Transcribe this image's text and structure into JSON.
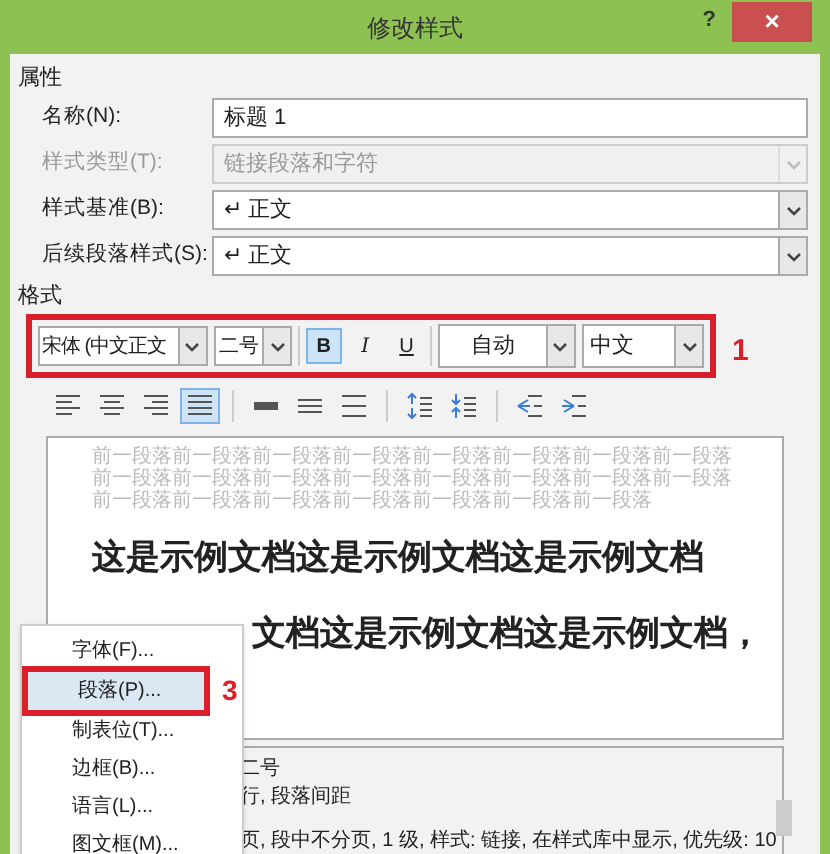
{
  "window": {
    "title": "修改样式",
    "help": "?",
    "close": "×"
  },
  "properties": {
    "heading": "属性",
    "fields": [
      {
        "label": "名称(N):",
        "value": "标题 1",
        "kind": "text",
        "disabled": false
      },
      {
        "label": "样式类型(T):",
        "value": "链接段落和字符",
        "kind": "select",
        "disabled": true
      },
      {
        "label": "样式基准(B):",
        "value": "↵ 正文",
        "kind": "select",
        "disabled": false
      },
      {
        "label": "后续段落样式(S):",
        "value": "↵ 正文",
        "kind": "select",
        "disabled": false
      }
    ]
  },
  "format": {
    "heading": "格式",
    "font": "宋体 (中文正文",
    "size": "二号",
    "styles": [
      {
        "label": "B",
        "kind": "bold",
        "selected": true
      },
      {
        "label": "I",
        "kind": "italic",
        "selected": false
      },
      {
        "label": "U",
        "kind": "underline",
        "selected": false
      }
    ],
    "text_color": "自动",
    "language": "中文",
    "callout": "1"
  },
  "paragraph_buttons": [
    {
      "kind": "align-left",
      "selected": false
    },
    {
      "kind": "align-center",
      "selected": false
    },
    {
      "kind": "align-right",
      "selected": false
    },
    {
      "kind": "justify",
      "selected": true
    },
    {
      "kind": "single",
      "selected": false
    },
    {
      "kind": "one-half",
      "selected": false
    },
    {
      "kind": "double",
      "selected": false
    },
    {
      "kind": "space-before",
      "selected": false
    },
    {
      "kind": "space-after",
      "selected": false
    },
    {
      "kind": "outdent",
      "selected": false
    },
    {
      "kind": "indent",
      "selected": false
    }
  ],
  "preview": {
    "previous_text": "前一段落前一段落前一段落前一段落前一段落前一段落前一段落前一段落前一段落前一段落前一段落前一段落前一段落前一段落前一段落前一段落前一段落前一段落前一段落前一段落前一段落前一段落前一段落",
    "lines": [
      "这是示例文档这是示例文档这是示例文档",
      "文档这是示例文档这是示例文档，"
    ]
  },
  "description": [
    "二号",
    "行, 段落间距",
    "页, 段中不分页, 1 级, 样式: 链接, 在样式库中显示, 优先级: 10"
  ],
  "menu": {
    "items": [
      {
        "label": "字体(F)...",
        "selected": false
      },
      {
        "label": "段落(P)...",
        "selected": true
      },
      {
        "label": "制表位(T)...",
        "selected": false
      },
      {
        "label": "边框(B)...",
        "selected": false
      },
      {
        "label": "语言(L)...",
        "selected": false
      },
      {
        "label": "图文框(M)...",
        "selected": false
      }
    ],
    "callout": "3"
  }
}
